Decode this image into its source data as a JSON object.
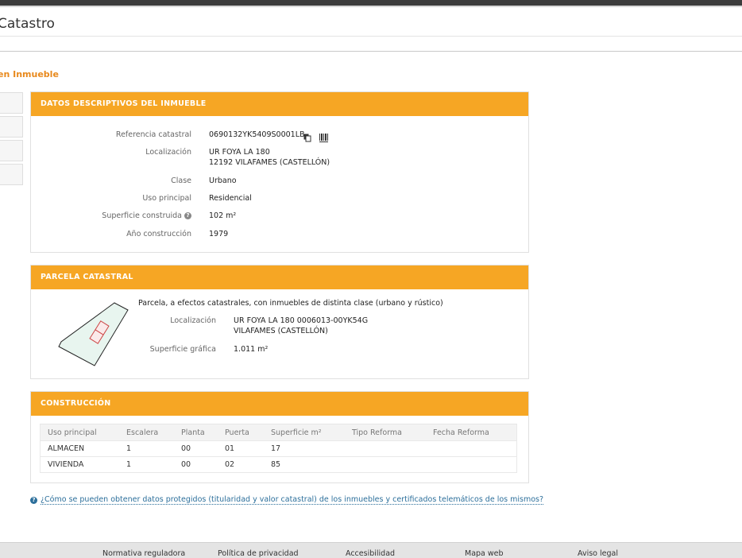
{
  "header": {
    "app_title": "Catastro",
    "page_heading": "en Inmueble"
  },
  "descriptive": {
    "title": "DATOS DESCRIPTIVOS DEL INMUEBLE",
    "ref_label": "Referencia catastral",
    "ref_value": "0690132YK5409S0001LB",
    "loc_label": "Localización",
    "loc_line1": "UR FOYA LA 180",
    "loc_line2": "12192 VILAFAMES (CASTELLÓN)",
    "clase_label": "Clase",
    "clase_value": "Urbano",
    "uso_label": "Uso principal",
    "uso_value": "Residencial",
    "sup_label": "Superficie construida",
    "sup_value": "102 m²",
    "year_label": "Año construcción",
    "year_value": "1979"
  },
  "parcela": {
    "title": "PARCELA CATASTRAL",
    "description": "Parcela, a efectos catastrales, con inmuebles de distinta clase (urbano y rústico)",
    "loc_label": "Localización",
    "loc_line1": "UR FOYA LA 180 0006013-00YK54G",
    "loc_line2": "VILAFAMES (CASTELLÓN)",
    "sup_label": "Superficie gráfica",
    "sup_value": "1.011 m²"
  },
  "construccion": {
    "title": "CONSTRUCCIÓN",
    "columns": [
      "Uso principal",
      "Escalera",
      "Planta",
      "Puerta",
      "Superficie m²",
      "Tipo Reforma",
      "Fecha Reforma"
    ],
    "rows": [
      [
        "ALMACEN",
        "1",
        "00",
        "01",
        "17",
        "",
        ""
      ],
      [
        "VIVIENDA",
        "1",
        "00",
        "02",
        "85",
        "",
        ""
      ]
    ]
  },
  "help": {
    "link_text": "¿Cómo se pueden obtener datos protegidos (titularidad y valor catastral) de los inmuebles y certificados telemáticos de los mismos?"
  },
  "footer": {
    "links": [
      "Normativa reguladora",
      "Política de privacidad",
      "Accesibilidad",
      "Mapa web",
      "Aviso legal"
    ]
  },
  "colors": {
    "accent": "#f6a624",
    "heading": "#e8891c",
    "link": "#2c6f9b"
  }
}
